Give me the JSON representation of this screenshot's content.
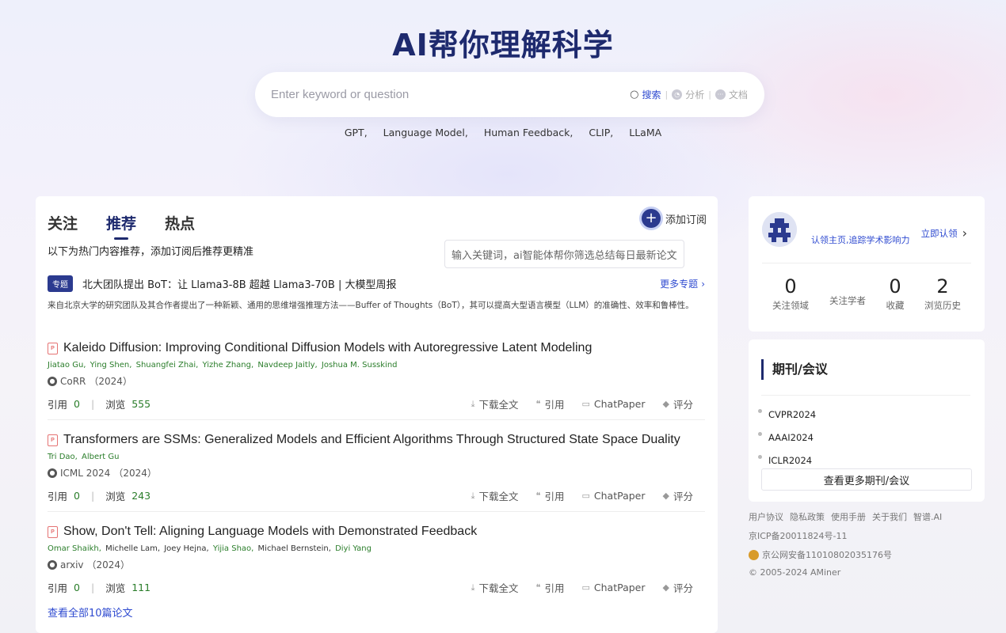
{
  "hero": {
    "title": "AI帮你理解科学"
  },
  "search": {
    "placeholder": "Enter keyword or question",
    "modes": [
      {
        "label": "搜索",
        "icon": "search-icon"
      },
      {
        "label": "分析",
        "icon": "analysis-icon"
      },
      {
        "label": "文档",
        "icon": "document-icon"
      }
    ]
  },
  "keywords": [
    "GPT,",
    "Language Model,",
    "Human Feedback,",
    "CLIP,",
    "LLaMA"
  ],
  "feed": {
    "tabs": [
      "关注",
      "推荐",
      "热点"
    ],
    "active_tab": "推荐",
    "add_subscription": "添加订阅",
    "subscription_tooltip": "输入关键词，ai智能体帮你筛选总结每日最新论文",
    "hint": "以下为热门内容推荐，添加订阅后推荐更精准",
    "topic": {
      "badge": "专题",
      "title": "北大团队提出 BoT：让 Llama3-8B 超越 Llama3-70B | 大模型周报",
      "more": "更多专题",
      "description": "来自北京大学的研究团队及其合作者提出了一种新颖、通用的思维增强推理方法——Buffer of Thoughts（BoT），其可以提高大型语言模型（LLM）的准确性、效率和鲁棒性。"
    },
    "papers": [
      {
        "title": "Kaleido Diffusion: Improving Conditional Diffusion Models with Autoregressive Latent Modeling",
        "authors": [
          {
            "name": "Jiatao Gu,",
            "linked": true
          },
          {
            "name": "Ying Shen,",
            "linked": true
          },
          {
            "name": "Shuangfei Zhai,",
            "linked": true
          },
          {
            "name": "Yizhe Zhang,",
            "linked": true
          },
          {
            "name": "Navdeep Jaitly,",
            "linked": true
          },
          {
            "name": "Joshua M. Susskind",
            "linked": true
          }
        ],
        "venue": "CoRR",
        "year": "（2024）",
        "citations": "0",
        "views": "555"
      },
      {
        "title": "Transformers are SSMs: Generalized Models and Efficient Algorithms Through Structured State Space Duality",
        "authors": [
          {
            "name": "Tri Dao,",
            "linked": true
          },
          {
            "name": "Albert Gu",
            "linked": true
          }
        ],
        "venue": "ICML 2024",
        "year": "（2024）",
        "citations": "0",
        "views": "243"
      },
      {
        "title": "Show, Don't Tell: Aligning Language Models with Demonstrated Feedback",
        "authors": [
          {
            "name": "Omar Shaikh,",
            "linked": true
          },
          {
            "name": "Michelle Lam,",
            "linked": false
          },
          {
            "name": "Joey Hejna,",
            "linked": false
          },
          {
            "name": "Yijia Shao,",
            "linked": true
          },
          {
            "name": "Michael Bernstein,",
            "linked": false
          },
          {
            "name": "Diyi Yang",
            "linked": true
          }
        ],
        "venue": "arxiv",
        "year": "（2024）",
        "citations": "0",
        "views": "111"
      }
    ],
    "labels": {
      "citations": "引用",
      "views": "浏览",
      "download": "下载全文",
      "cite": "引用",
      "chatpaper": "ChatPaper",
      "rate": "评分"
    },
    "view_all": "查看全部10篇论文"
  },
  "profile": {
    "claim_text": "认领主页,追踪学术影响力",
    "claim_link": "立即认领",
    "stats": [
      {
        "num": "0",
        "label": "关注领域"
      },
      {
        "num": "",
        "label": "关注学者"
      },
      {
        "num": "0",
        "label": "收藏"
      },
      {
        "num": "2",
        "label": "浏览历史"
      }
    ]
  },
  "journals": {
    "title": "期刊/会议",
    "items": [
      "CVPR2024",
      "AAAI2024",
      "ICLR2024"
    ],
    "more": "查看更多期刊/会议"
  },
  "footer": {
    "links": [
      "用户协议",
      "隐私政策",
      "使用手册",
      "关于我们",
      "智谱.AI"
    ],
    "icp": "京ICP备20011824号-11",
    "police": "京公网安备11010802035176号",
    "copyright": "© 2005-2024 AMiner"
  },
  "colors": {
    "brand": "#1e2a6e",
    "accent": "#2f4bd0",
    "link_green": "#2a7d2a"
  }
}
